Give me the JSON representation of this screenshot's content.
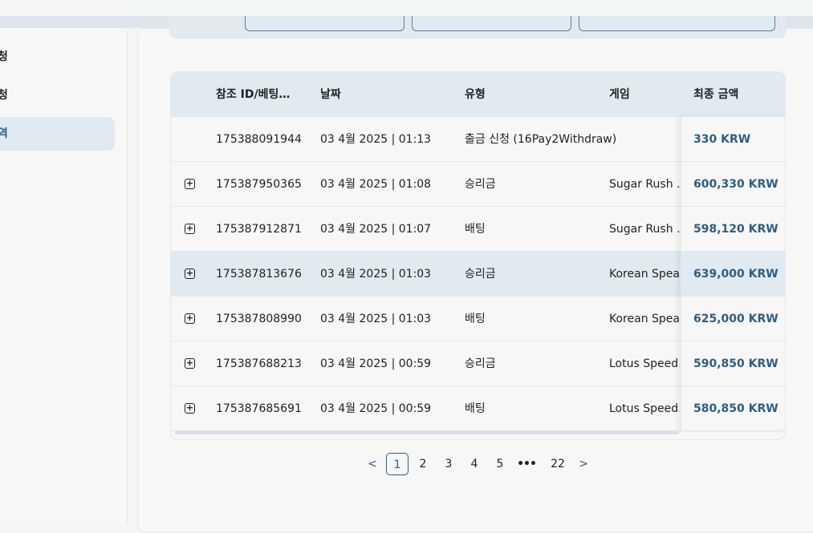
{
  "sidebar": {
    "items": [
      {
        "label": "청",
        "active": false
      },
      {
        "label": "청",
        "active": false
      },
      {
        "label": "역",
        "active": true
      }
    ]
  },
  "table": {
    "headers": {
      "ref": "참조 ID/베팅…",
      "date": "날짜",
      "type": "유형",
      "game": "게임",
      "amount": "최종 금액"
    },
    "rows": [
      {
        "expandable": false,
        "ref": "175388091944",
        "date": "03 4월 2025 | 01:13",
        "type": "출금 신청 (16Pay2Withdraw)",
        "game": "",
        "amount": "330 KRW"
      },
      {
        "expandable": true,
        "ref": "175387950365",
        "date": "03 4월 2025 | 01:08",
        "type": "승리금",
        "game": "Sugar Rush …",
        "amount": "600,330 KRW"
      },
      {
        "expandable": true,
        "ref": "175387912871",
        "date": "03 4월 2025 | 01:07",
        "type": "배팅",
        "game": "Sugar Rush …",
        "amount": "598,120 KRW"
      },
      {
        "expandable": true,
        "ref": "175387813676",
        "date": "03 4월 2025 | 01:03",
        "type": "승리금",
        "game": "Korean Spea…",
        "amount": "639,000 KRW",
        "highlighted": true
      },
      {
        "expandable": true,
        "ref": "175387808990",
        "date": "03 4월 2025 | 01:03",
        "type": "배팅",
        "game": "Korean Spea…",
        "amount": "625,000 KRW"
      },
      {
        "expandable": true,
        "ref": "175387688213",
        "date": "03 4월 2025 | 00:59",
        "type": "승리금",
        "game": "Lotus Speed…",
        "amount": "590,850 KRW"
      },
      {
        "expandable": true,
        "ref": "175387685691",
        "date": "03 4월 2025 | 00:59",
        "type": "배팅",
        "game": "Lotus Speed…",
        "amount": "580,850 KRW"
      }
    ]
  },
  "pagination": {
    "prev": "<",
    "next": ">",
    "pages": [
      "1",
      "2",
      "3",
      "4",
      "5"
    ],
    "ellipsis": "•••",
    "last": "22",
    "current": "1"
  },
  "colors": {
    "accent": "#2f5e82",
    "header_bg": "#e1e9f1",
    "panel_bg": "#f7f7f7"
  }
}
